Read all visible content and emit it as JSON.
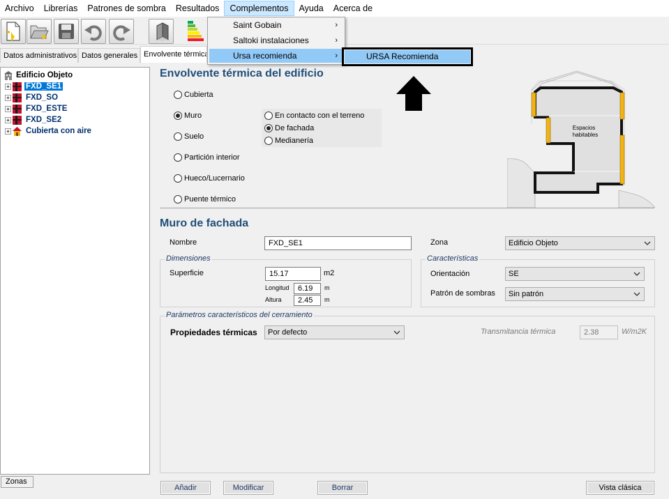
{
  "menubar": {
    "items": [
      "Archivo",
      "Librerías",
      "Patrones de sombra",
      "Resultados",
      "Complementos",
      "Ayuda",
      "Acerca de"
    ],
    "active_index": 4
  },
  "complementos_menu": {
    "items": [
      "Saint Gobain",
      "Saltoki instalaciones",
      "Ursa recomienda"
    ],
    "arrow": "›",
    "highlighted_index": 2
  },
  "ursa_submenu": {
    "items": [
      "URSA Recomienda"
    ]
  },
  "tabs": {
    "items": [
      "Datos administrativos",
      "Datos generales",
      "Envolvente térmica"
    ],
    "active_index": 2
  },
  "tree": {
    "root": "Edificio Objeto",
    "items": [
      {
        "label": "FXD_SE1",
        "selected": true
      },
      {
        "label": "FXD_SO",
        "selected": false
      },
      {
        "label": "FXD_ESTE",
        "selected": false
      },
      {
        "label": "FXD_SE2",
        "selected": false
      },
      {
        "label": "Cubierta con aire",
        "selected": false
      }
    ],
    "expander": "+"
  },
  "zonas_tab": "Zonas",
  "envolvente": {
    "title": "Envolvente térmica del edificio",
    "options": [
      "Cubierta",
      "Muro",
      "Suelo",
      "Partición interior",
      "Hueco/Lucernario",
      "Puente térmico"
    ],
    "selected_option": "Muro",
    "muro_suboptions": [
      "En contacto con el terreno",
      "De fachada",
      "Medianería"
    ],
    "selected_suboption": "De fachada",
    "diagram_label": [
      "Espacios",
      "habitables"
    ]
  },
  "muro": {
    "title": "Muro de fachada",
    "nombre_label": "Nombre",
    "nombre_value": "FXD_SE1",
    "zona_label": "Zona",
    "zona_value": "Edificio Objeto"
  },
  "dimensiones": {
    "title": "Dimensiones",
    "superficie_label": "Superficie",
    "superficie_value": "15.17",
    "superficie_unit": "m2",
    "longitud_label": "Longitud",
    "longitud_value": "6.19",
    "altura_label": "Altura",
    "altura_value": "2.45",
    "unit_m": "m"
  },
  "caracteristicas": {
    "title": "Características",
    "orientacion_label": "Orientación",
    "orientacion_value": "SE",
    "patron_label": "Patrón de sombras",
    "patron_value": "Sin patrón"
  },
  "parametros": {
    "title": "Parámetros característicos del cerramiento",
    "propiedades_label": "Propiedades térmicas",
    "propiedades_value": "Por defecto",
    "transmitancia_label": "Transmitancia térmica",
    "transmitancia_value": "2.38",
    "transmitancia_unit": "W/m2K"
  },
  "buttons": {
    "anadir": "Añadir",
    "modificar": "Modificar",
    "borrar": "Borrar",
    "vista_clasica": "Vista clásica"
  },
  "colors": {
    "title_blue": "#1f4e79",
    "selection_blue": "#0078d7",
    "menu_highlight": "#91c9f7",
    "diagram_yellow": "#f2b318"
  },
  "icons": [
    "new-document-icon",
    "open-folder-icon",
    "save-icon",
    "undo-icon",
    "redo-icon",
    "3d-view-icon",
    "energy-rating-icon",
    "building-icon",
    "wall-icon",
    "house-icon",
    "up-arrow-icon"
  ]
}
